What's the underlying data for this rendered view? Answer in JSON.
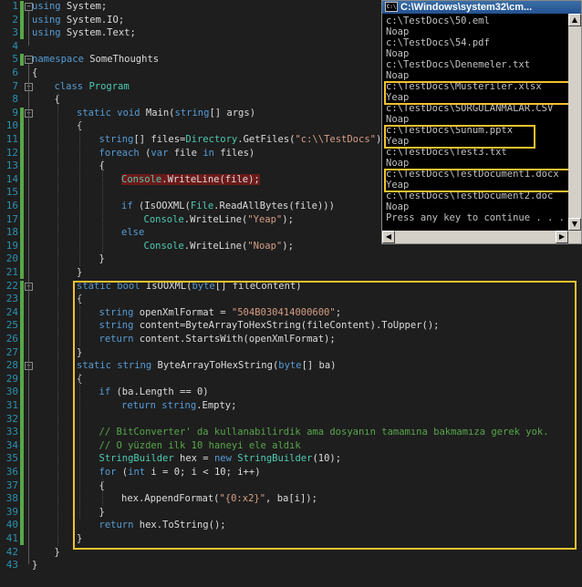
{
  "editor": {
    "line_numbers": [
      "1",
      "2",
      "3",
      "4",
      "5",
      "6",
      "7",
      "8",
      "9",
      "10",
      "11",
      "12",
      "13",
      "14",
      "15",
      "16",
      "17",
      "18",
      "19",
      "20",
      "21",
      "22",
      "23",
      "24",
      "25",
      "26",
      "27",
      "28",
      "29",
      "30",
      "31",
      "32",
      "33",
      "34",
      "35",
      "36",
      "37",
      "38",
      "39",
      "40",
      "41",
      "42",
      "43"
    ],
    "code": [
      {
        "indent": 0,
        "tokens": [
          {
            "t": "using",
            "c": "kw"
          },
          {
            "t": " System;"
          }
        ]
      },
      {
        "indent": 0,
        "tokens": [
          {
            "t": "using",
            "c": "kw"
          },
          {
            "t": " System.IO;"
          }
        ]
      },
      {
        "indent": 0,
        "tokens": [
          {
            "t": "using",
            "c": "kw"
          },
          {
            "t": " System.Text;"
          }
        ]
      },
      {
        "indent": 0,
        "tokens": []
      },
      {
        "indent": 0,
        "tokens": [
          {
            "t": "namespace",
            "c": "kw"
          },
          {
            "t": " SomeThoughts"
          }
        ]
      },
      {
        "indent": 0,
        "tokens": [
          {
            "t": "{"
          }
        ]
      },
      {
        "indent": 1,
        "tokens": [
          {
            "t": "class",
            "c": "kw"
          },
          {
            "t": " "
          },
          {
            "t": "Program",
            "c": "ty"
          }
        ]
      },
      {
        "indent": 1,
        "tokens": [
          {
            "t": "{"
          }
        ]
      },
      {
        "indent": 2,
        "tokens": [
          {
            "t": "static",
            "c": "kw"
          },
          {
            "t": " "
          },
          {
            "t": "void",
            "c": "kw"
          },
          {
            "t": " Main("
          },
          {
            "t": "string",
            "c": "kw"
          },
          {
            "t": "[] args)"
          }
        ]
      },
      {
        "indent": 2,
        "tokens": [
          {
            "t": "{"
          }
        ]
      },
      {
        "indent": 3,
        "tokens": [
          {
            "t": "string",
            "c": "kw"
          },
          {
            "t": "[] files="
          },
          {
            "t": "Directory",
            "c": "ty"
          },
          {
            "t": ".GetFiles("
          },
          {
            "t": "\"c:\\\\TestDocs\"",
            "c": "st"
          },
          {
            "t": ");"
          }
        ]
      },
      {
        "indent": 3,
        "tokens": [
          {
            "t": "foreach",
            "c": "kw"
          },
          {
            "t": " ("
          },
          {
            "t": "var",
            "c": "kw"
          },
          {
            "t": " file "
          },
          {
            "t": "in",
            "c": "kw"
          },
          {
            "t": " files)"
          }
        ]
      },
      {
        "indent": 3,
        "tokens": [
          {
            "t": "{"
          }
        ]
      },
      {
        "indent": 4,
        "tokens": [
          {
            "t": "Console",
            "c": "ty",
            "hl": true
          },
          {
            "t": ".WriteLine(file);",
            "hl": true
          }
        ]
      },
      {
        "indent": 0,
        "tokens": []
      },
      {
        "indent": 4,
        "tokens": [
          {
            "t": "if",
            "c": "kw"
          },
          {
            "t": " (IsOOXML("
          },
          {
            "t": "File",
            "c": "ty"
          },
          {
            "t": ".ReadAllBytes(file)))"
          }
        ]
      },
      {
        "indent": 5,
        "tokens": [
          {
            "t": "Console",
            "c": "ty"
          },
          {
            "t": ".WriteLine("
          },
          {
            "t": "\"Yeap\"",
            "c": "st"
          },
          {
            "t": ");"
          }
        ]
      },
      {
        "indent": 4,
        "tokens": [
          {
            "t": "else",
            "c": "kw"
          }
        ]
      },
      {
        "indent": 5,
        "tokens": [
          {
            "t": "Console",
            "c": "ty"
          },
          {
            "t": ".WriteLine("
          },
          {
            "t": "\"Noap\"",
            "c": "st"
          },
          {
            "t": ");"
          }
        ]
      },
      {
        "indent": 3,
        "tokens": [
          {
            "t": "}"
          }
        ]
      },
      {
        "indent": 2,
        "tokens": [
          {
            "t": "}"
          }
        ]
      },
      {
        "indent": 2,
        "tokens": [
          {
            "t": "static",
            "c": "kw"
          },
          {
            "t": " "
          },
          {
            "t": "bool",
            "c": "kw"
          },
          {
            "t": " IsOOXML("
          },
          {
            "t": "byte",
            "c": "kw"
          },
          {
            "t": "[] fileContent)"
          }
        ]
      },
      {
        "indent": 2,
        "tokens": [
          {
            "t": "{"
          }
        ]
      },
      {
        "indent": 3,
        "tokens": [
          {
            "t": "string",
            "c": "kw"
          },
          {
            "t": " openXmlFormat = "
          },
          {
            "t": "\"504B030414000600\"",
            "c": "st"
          },
          {
            "t": ";"
          }
        ]
      },
      {
        "indent": 3,
        "tokens": [
          {
            "t": "string",
            "c": "kw"
          },
          {
            "t": " content=ByteArrayToHexString(fileContent).ToUpper();"
          }
        ]
      },
      {
        "indent": 3,
        "tokens": [
          {
            "t": "return",
            "c": "kw"
          },
          {
            "t": " content.StartsWith(openXmlFormat);"
          }
        ]
      },
      {
        "indent": 2,
        "tokens": [
          {
            "t": "}"
          }
        ]
      },
      {
        "indent": 2,
        "tokens": [
          {
            "t": "static",
            "c": "kw"
          },
          {
            "t": " "
          },
          {
            "t": "string",
            "c": "kw"
          },
          {
            "t": " ByteArrayToHexString("
          },
          {
            "t": "byte",
            "c": "kw"
          },
          {
            "t": "[] ba)"
          }
        ]
      },
      {
        "indent": 2,
        "tokens": [
          {
            "t": "{"
          }
        ]
      },
      {
        "indent": 3,
        "tokens": [
          {
            "t": "if",
            "c": "kw"
          },
          {
            "t": " (ba.Length == 0)"
          }
        ]
      },
      {
        "indent": 4,
        "tokens": [
          {
            "t": "return",
            "c": "kw"
          },
          {
            "t": " "
          },
          {
            "t": "string",
            "c": "kw"
          },
          {
            "t": ".Empty;"
          }
        ]
      },
      {
        "indent": 0,
        "tokens": []
      },
      {
        "indent": 3,
        "tokens": [
          {
            "t": "// BitConverter' da kullanabilirdik ama dosyanın tamamına bakmamıza gerek yok.",
            "c": "cm"
          }
        ]
      },
      {
        "indent": 3,
        "tokens": [
          {
            "t": "// O yüzden ilk 10 haneyi ele aldık",
            "c": "cm"
          }
        ]
      },
      {
        "indent": 3,
        "tokens": [
          {
            "t": "StringBuilder",
            "c": "ty"
          },
          {
            "t": " hex = "
          },
          {
            "t": "new",
            "c": "kw"
          },
          {
            "t": " "
          },
          {
            "t": "StringBuilder",
            "c": "ty"
          },
          {
            "t": "(10);"
          }
        ]
      },
      {
        "indent": 3,
        "tokens": [
          {
            "t": "for",
            "c": "kw"
          },
          {
            "t": " ("
          },
          {
            "t": "int",
            "c": "kw"
          },
          {
            "t": " i = 0; i < 10; i++)"
          }
        ]
      },
      {
        "indent": 3,
        "tokens": [
          {
            "t": "{"
          }
        ]
      },
      {
        "indent": 4,
        "tokens": [
          {
            "t": "hex.AppendFormat("
          },
          {
            "t": "\"{0:x2}\"",
            "c": "st"
          },
          {
            "t": ", ba[i]);"
          }
        ]
      },
      {
        "indent": 3,
        "tokens": [
          {
            "t": "}"
          }
        ]
      },
      {
        "indent": 3,
        "tokens": [
          {
            "t": "return",
            "c": "kw"
          },
          {
            "t": " hex.ToString();"
          }
        ]
      },
      {
        "indent": 2,
        "tokens": [
          {
            "t": "}"
          }
        ]
      },
      {
        "indent": 1,
        "tokens": [
          {
            "t": "}"
          }
        ]
      },
      {
        "indent": 0,
        "tokens": [
          {
            "t": "}"
          }
        ]
      }
    ]
  },
  "console": {
    "title": "C:\\Windows\\system32\\cm...",
    "icon_text": "C:\\",
    "lines": [
      "c:\\TestDocs\\50.eml",
      "Noap",
      "c:\\TestDocs\\54.pdf",
      "Noap",
      "c:\\TestDocs\\Denemeler.txt",
      "Noap",
      "c:\\TestDocs\\Musteriler.xlsx",
      "Yeap",
      "c:\\TestDocs\\SORGULANMALAR.CSV",
      "Noap",
      "c:\\TestDocs\\Sunum.pptx",
      "Yeap",
      "c:\\TestDocs\\Test3.txt",
      "Noap",
      "c:\\TestDocs\\TestDocument1.docx",
      "Yeap",
      "c:\\TestDocs\\TestDocument2.doc",
      "Noap",
      "Press any key to continue . . ."
    ]
  },
  "colors": {
    "highlight_box": "#f2c12e",
    "keyword": "#569cd6",
    "type": "#4ec9b0",
    "string": "#d69d85",
    "comment": "#57a64a"
  }
}
